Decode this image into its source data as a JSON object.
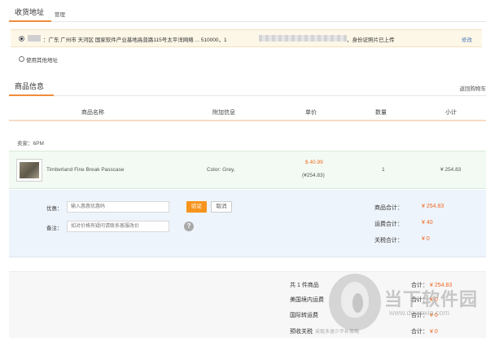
{
  "address": {
    "section_title": "收货地址",
    "manage_label": "管理",
    "selected_address": "：广东 广州市 天河区 国家软件产业基地高普路115号太平洋网络 ... 510000，1",
    "id_status": "，身份证照片已上传",
    "edit_label": "修改",
    "use_other_label": "使用其他地址"
  },
  "goods": {
    "section_title": "商品信息",
    "back_to_cart": "返回购物车",
    "columns": [
      "商品名称",
      "附加信息",
      "单价",
      "数量",
      "小计"
    ],
    "seller": "卖家：6PM",
    "item": {
      "name": "Timberland Fine Break Passcase",
      "extra": "Color: Grey,",
      "price_usd": "$ 40.99",
      "price_cny": "(¥254.83)",
      "quantity": "1",
      "subtotal": "¥ 254.83"
    }
  },
  "promo": {
    "coupon_label": "优惠：",
    "coupon_placeholder": "输入惠惠优惠码",
    "verify_button": "验证",
    "cancel_button": "取消",
    "note_label": "备注：",
    "note_placeholder": "如对价格有疑问请联系客服改价",
    "help_icon": "?",
    "summary": [
      {
        "label": "商品合计：",
        "value": "¥ 254.83"
      },
      {
        "label": "运费合计：",
        "value": "¥ 40"
      },
      {
        "label": "关税合计：",
        "value": "¥ 0"
      }
    ]
  },
  "bottom": {
    "rows": [
      {
        "label": "共 1 件商品",
        "note": "",
        "right_label": "合计：",
        "right_value": "¥ 254.83"
      },
      {
        "label": "美国境内运费",
        "note": "",
        "right_label": "合计：",
        "right_value": "¥ 0"
      },
      {
        "label": "国际转运费",
        "note": "",
        "right_label": "合计：",
        "right_value": "¥ 0"
      },
      {
        "label": "预收关税",
        "note": "采取多退少不补策略",
        "right_label": "合计：",
        "right_value": "¥ 0"
      }
    ]
  },
  "watermark": {
    "text": "当下软件园",
    "url": "www.downxia.com"
  },
  "colors": {
    "accent": "#f08c3c",
    "price": "#f06a22",
    "link": "#4a7bb7",
    "verify_button": "#f7941d"
  }
}
